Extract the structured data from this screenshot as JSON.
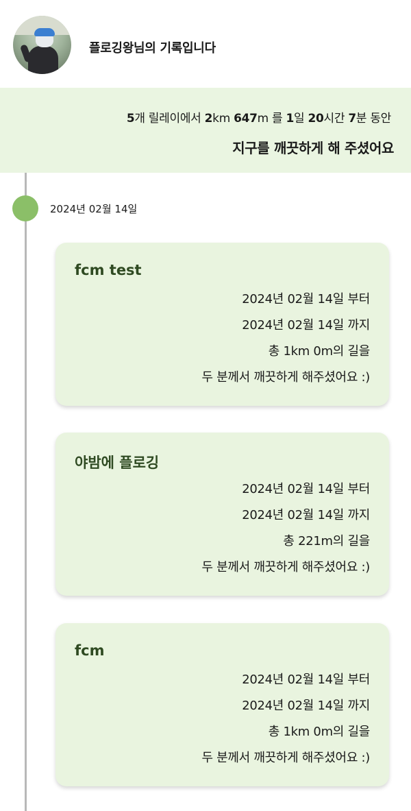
{
  "profile": {
    "name": "플로깅왕님의 기록입니다"
  },
  "summary": {
    "relay_count": "5",
    "relay_unit": "개 릴레이에서",
    "distance_km": "2",
    "distance_km_unit": "km",
    "distance_m": "647",
    "distance_m_unit": "m 를",
    "days": "1",
    "days_unit": "일",
    "hours": "20",
    "hours_unit": "시간",
    "minutes": "7",
    "minutes_unit": "분 동안",
    "thanks": "지구를 깨끗하게 해 주셨어요"
  },
  "timeline": {
    "date": "2024년 02월 14일",
    "records": [
      {
        "title": "fcm test",
        "start": "2024년 02월 14일 부터",
        "end": "2024년 02월 14일 까지",
        "distance": "총 1km 0m의 길을",
        "people": "두 분께서 깨끗하게 해주셨어요 :)"
      },
      {
        "title": "야밤에 플로깅",
        "start": "2024년 02월 14일 부터",
        "end": "2024년 02월 14일 까지",
        "distance": "총  221m의 길을",
        "people": "두 분께서 깨끗하게 해주셨어요 :)"
      },
      {
        "title": "fcm",
        "start": "2024년 02월 14일 부터",
        "end": "2024년 02월 14일 까지",
        "distance": "총 1km 0m의 길을",
        "people": "두 분께서 깨끗하게 해주셨어요 :)"
      }
    ]
  }
}
